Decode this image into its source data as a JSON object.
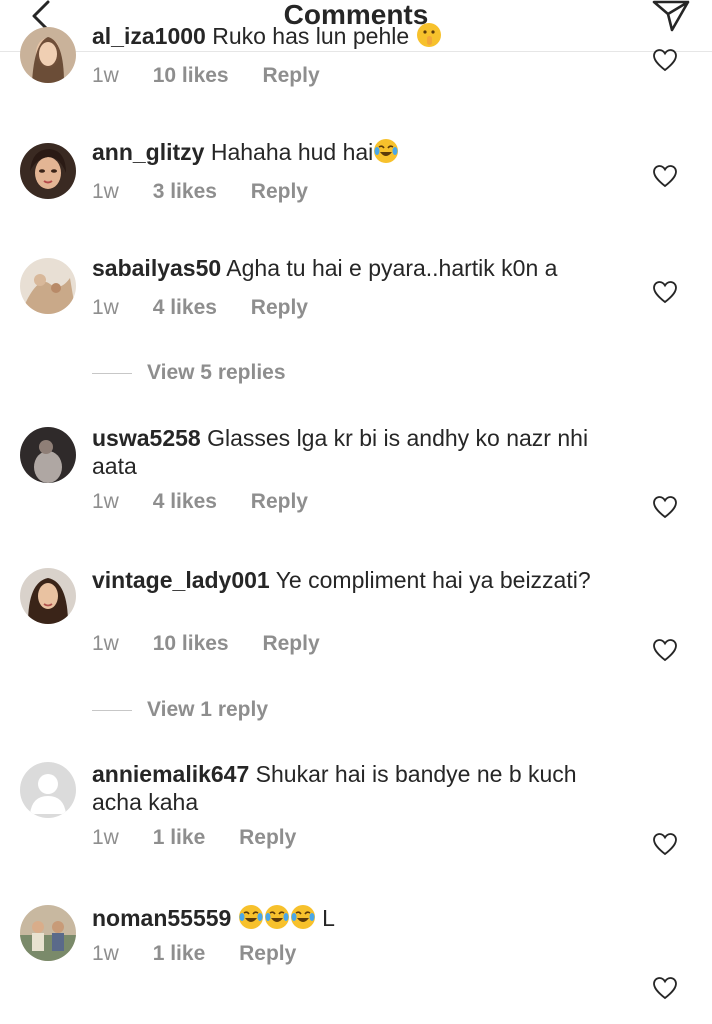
{
  "header": {
    "title": "Comments",
    "back_icon": "chevron-left-icon",
    "send_icon": "paper-plane-icon"
  },
  "comments": [
    {
      "username": "al_iza1000",
      "text": "Ruko has lun pehle",
      "time": "1w",
      "likes": "10 likes",
      "reply": "Reply",
      "emoji": [
        "shushing-face"
      ]
    },
    {
      "username": "ann_glitzy",
      "text": "Hahaha hud hai",
      "time": "1w",
      "likes": "3 likes",
      "reply": "Reply",
      "emoji": [
        "face-with-tears-of-joy"
      ]
    },
    {
      "username": "sabailyas50",
      "text": "Agha tu hai e pyara..hartik k0n a",
      "time": "1w",
      "likes": "4 likes",
      "reply": "Reply"
    },
    {
      "username": "uswa5258",
      "text": "Glasses lga kr bi is andhy ko nazr nhi aata",
      "time": "1w",
      "likes": "4 likes",
      "reply": "Reply"
    },
    {
      "username": "vintage_lady001",
      "text": "Ye compliment hai ya beizzati?",
      "time": "1w",
      "likes": "10 likes",
      "reply": "Reply"
    },
    {
      "username": "anniemalik647",
      "text": "Shukar hai is bandye ne b kuch acha kaha",
      "time": "1w",
      "likes": "1 like",
      "reply": "Reply"
    },
    {
      "username": "noman55559",
      "text": "L",
      "time": "1w",
      "likes": "1 like",
      "reply": "Reply",
      "emoji": [
        "face-with-tears-of-joy",
        "face-with-tears-of-joy",
        "face-with-tears-of-joy"
      ]
    }
  ],
  "view_replies": [
    {
      "text": "View 5 replies"
    },
    {
      "text": "View 1 reply"
    }
  ],
  "colors": {
    "text": "#262626",
    "secondary": "#8e8e8e",
    "divider": "#e6e6e6"
  }
}
